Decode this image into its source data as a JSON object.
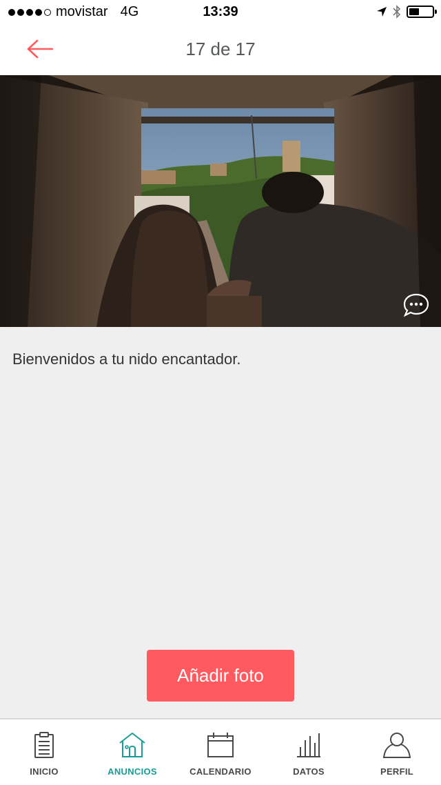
{
  "status_bar": {
    "carrier": "movistar",
    "network": "4G",
    "time": "13:39",
    "signal_bars": 4,
    "battery_level": 0.35
  },
  "nav": {
    "back_icon": "arrow-left-icon",
    "title": "17 de 17"
  },
  "photo": {
    "comment_icon": "speech-bubble-icon"
  },
  "caption": "Bienvenidos a tu nido encantador.",
  "add_photo_label": "Añadir foto",
  "tabs": [
    {
      "label": "INICIO",
      "icon": "clipboard-icon",
      "active": false
    },
    {
      "label": "ANUNCIOS",
      "icon": "house-icon",
      "active": true
    },
    {
      "label": "CALENDARIO",
      "icon": "calendar-icon",
      "active": false
    },
    {
      "label": "DATOS",
      "icon": "bar-chart-icon",
      "active": false
    },
    {
      "label": "PERFIL",
      "icon": "person-icon",
      "active": false
    }
  ],
  "colors": {
    "accent": "#ff5a5f",
    "active_tab": "#179c96",
    "background": "#efefef"
  }
}
